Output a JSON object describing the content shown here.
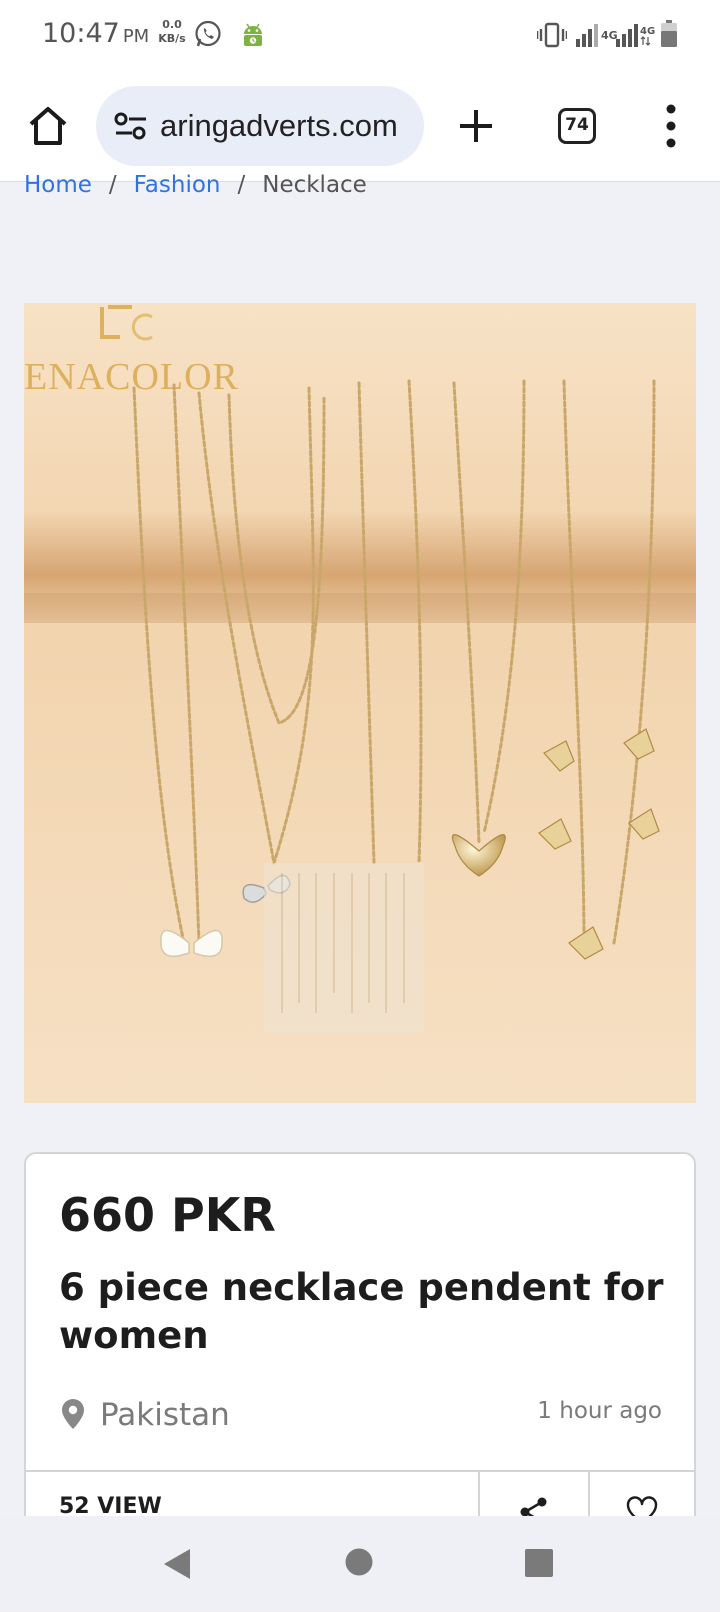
{
  "status_bar": {
    "time": "10:47",
    "ampm": "PM",
    "net_speed_value": "0.0",
    "net_speed_unit": "KB/s",
    "icons": [
      "whatsapp-icon",
      "android-icon",
      "vibrate-icon",
      "signal-4g-icon",
      "signal-4g-icon",
      "battery-icon"
    ],
    "network_label_1": "4G",
    "network_label_2": "4G"
  },
  "browser": {
    "url": "aringadverts.com",
    "tab_count": "74",
    "icons": [
      "home-icon",
      "site-settings-icon",
      "plus-icon",
      "more-vert-icon"
    ]
  },
  "breadcrumb": {
    "items": [
      "Home",
      "Fashion",
      "Necklace"
    ],
    "separator": "/"
  },
  "product": {
    "image_watermark": "ENACOLOR",
    "price": "660 PKR",
    "title": "6 piece necklace pendent for women",
    "location": "Pakistan",
    "posted": "1 hour ago",
    "views": "52 VIEW"
  },
  "colors": {
    "link": "#2f73e0",
    "card_border": "#d5d5d8",
    "page_background": "#f0f1f6",
    "image_background": "#f6e0c2"
  },
  "nav_bar": {
    "icons": [
      "back-icon",
      "home-circle-icon",
      "recents-icon"
    ]
  }
}
